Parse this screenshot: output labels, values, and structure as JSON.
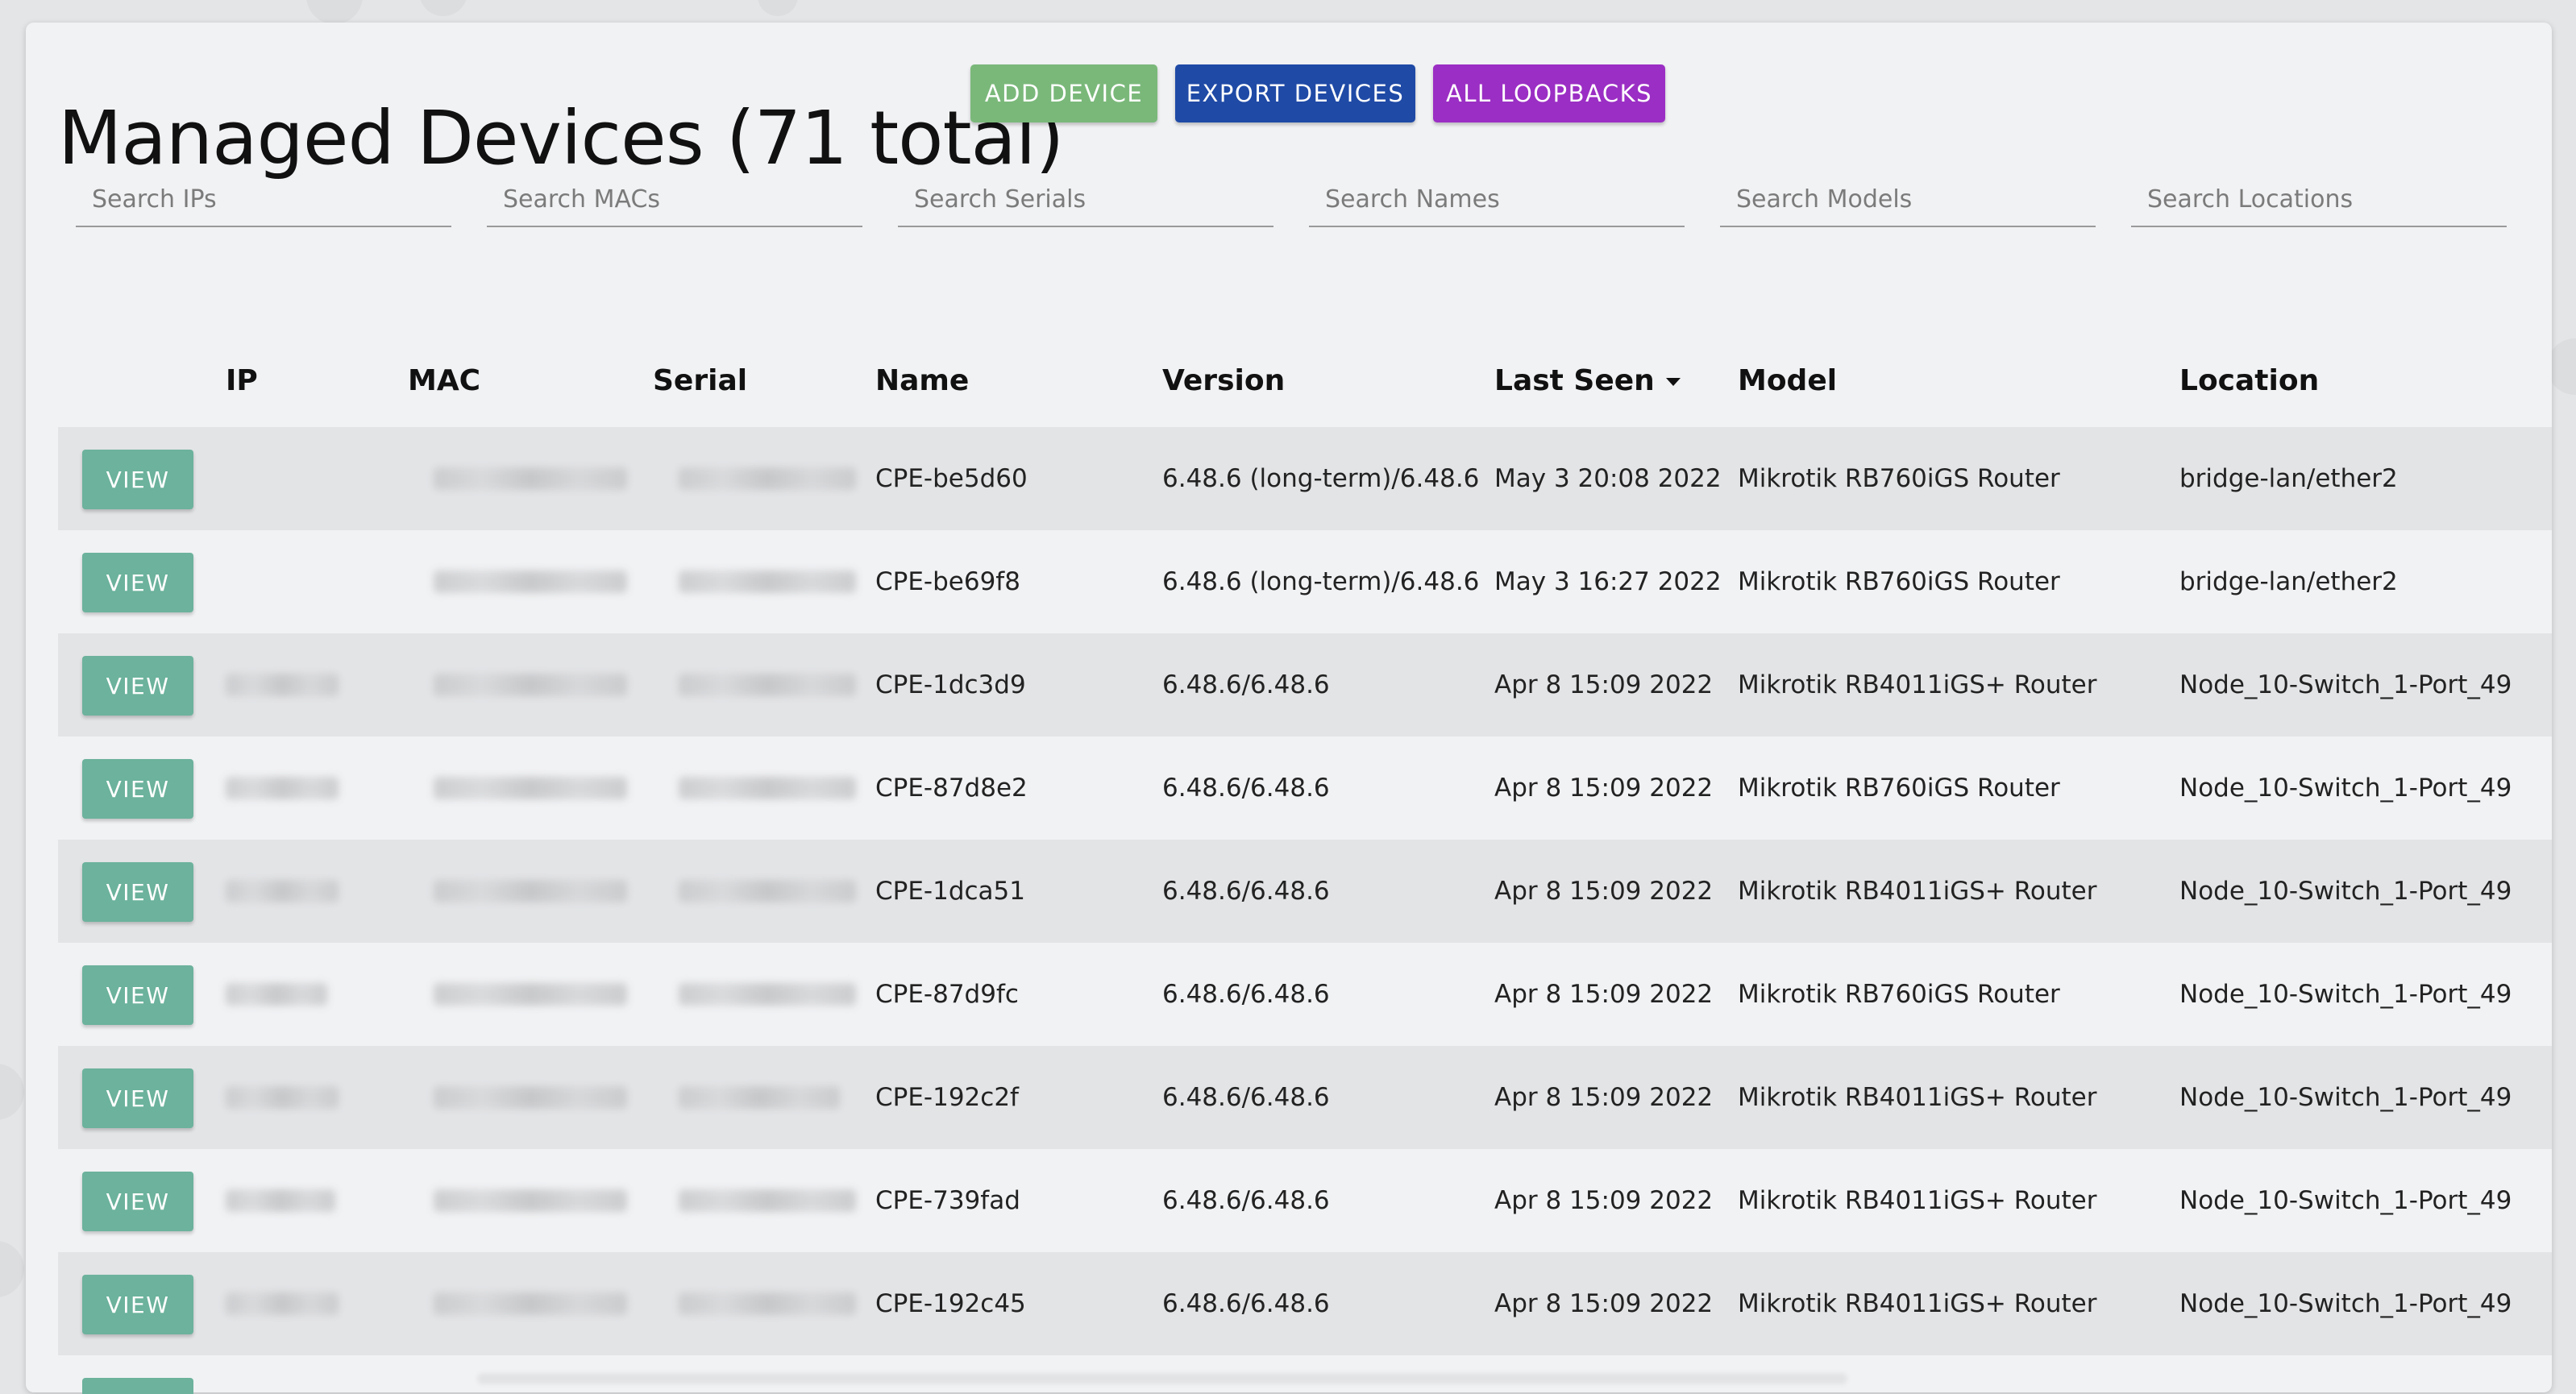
{
  "page": {
    "title": "Managed Devices (71 total)"
  },
  "actions": {
    "add_device": "ADD DEVICE",
    "export_devices": "EXPORT DEVICES",
    "all_loopbacks": "ALL LOOPBACKS"
  },
  "colors": {
    "add_device": "#7ab87a",
    "export_devices": "#1f4aa6",
    "all_loopbacks": "#9b2ec4",
    "view_button": "#6cb29c"
  },
  "filters": {
    "ips": "Search IPs",
    "macs": "Search MACs",
    "serials": "Search Serials",
    "names": "Search Names",
    "models": "Search Models",
    "locations": "Search Locations"
  },
  "table": {
    "headers": {
      "ip": "IP",
      "mac": "MAC",
      "serial": "Serial",
      "name": "Name",
      "version": "Version",
      "last_seen": "Last Seen",
      "model": "Model",
      "location": "Location"
    },
    "sorted_by": "last_seen",
    "sort_direction": "descending",
    "view_label": "VIEW",
    "rows": [
      {
        "name": "CPE-be5d60",
        "version": "6.48.6 (long-term)/6.48.6",
        "last_seen": "May 3 20:08 2022",
        "model": "Mikrotik RB760iGS Router",
        "location": "bridge-lan/ether2"
      },
      {
        "name": "CPE-be69f8",
        "version": "6.48.6 (long-term)/6.48.6",
        "last_seen": "May 3 16:27 2022",
        "model": "Mikrotik RB760iGS Router",
        "location": "bridge-lan/ether2"
      },
      {
        "name": "CPE-1dc3d9",
        "version": "6.48.6/6.48.6",
        "last_seen": "Apr 8 15:09 2022",
        "model": "Mikrotik RB4011iGS+ Router",
        "location": "Node_10-Switch_1-Port_49"
      },
      {
        "name": "CPE-87d8e2",
        "version": "6.48.6/6.48.6",
        "last_seen": "Apr 8 15:09 2022",
        "model": "Mikrotik RB760iGS Router",
        "location": "Node_10-Switch_1-Port_49"
      },
      {
        "name": "CPE-1dca51",
        "version": "6.48.6/6.48.6",
        "last_seen": "Apr 8 15:09 2022",
        "model": "Mikrotik RB4011iGS+ Router",
        "location": "Node_10-Switch_1-Port_49"
      },
      {
        "name": "CPE-87d9fc",
        "version": "6.48.6/6.48.6",
        "last_seen": "Apr 8 15:09 2022",
        "model": "Mikrotik RB760iGS Router",
        "location": "Node_10-Switch_1-Port_49"
      },
      {
        "name": "CPE-192c2f",
        "version": "6.48.6/6.48.6",
        "last_seen": "Apr 8 15:09 2022",
        "model": "Mikrotik RB4011iGS+ Router",
        "location": "Node_10-Switch_1-Port_49"
      },
      {
        "name": "CPE-739fad",
        "version": "6.48.6/6.48.6",
        "last_seen": "Apr 8 15:09 2022",
        "model": "Mikrotik RB4011iGS+ Router",
        "location": "Node_10-Switch_1-Port_49"
      },
      {
        "name": "CPE-192c45",
        "version": "6.48.6/6.48.6",
        "last_seen": "Apr 8 15:09 2022",
        "model": "Mikrotik RB4011iGS+ Router",
        "location": "Node_10-Switch_1-Port_49"
      }
    ]
  }
}
